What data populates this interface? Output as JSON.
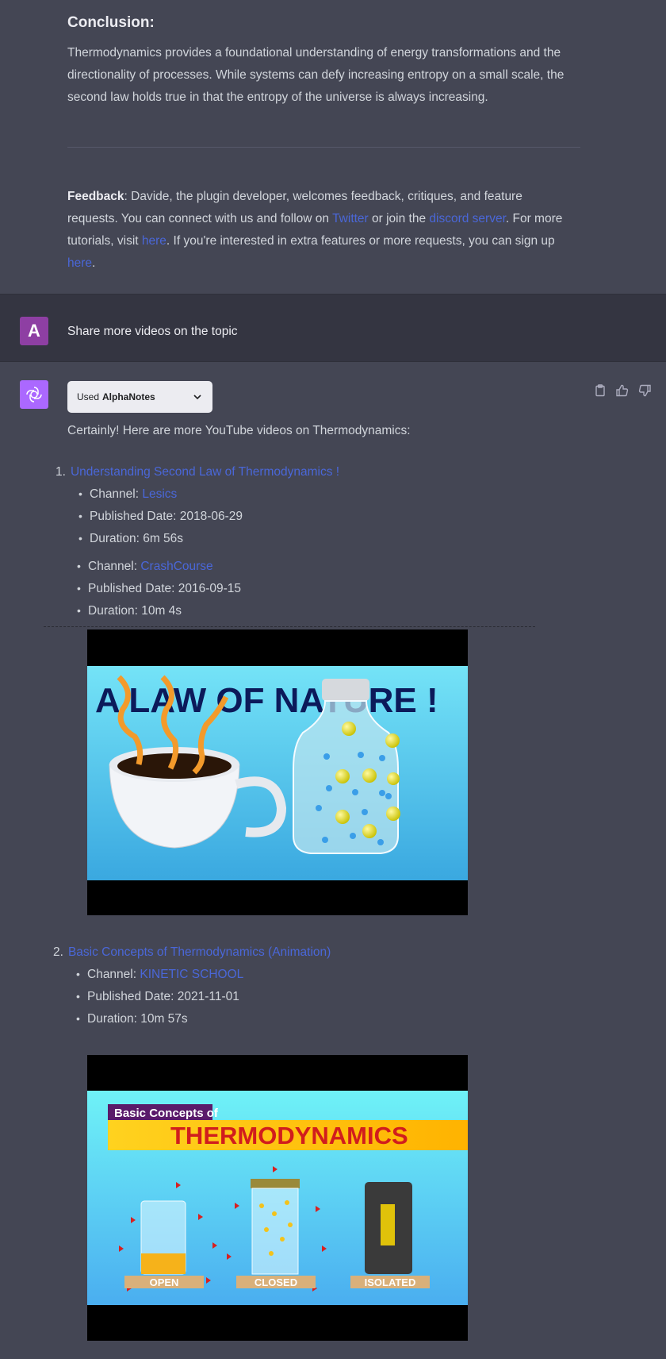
{
  "conclusion": {
    "heading": "Conclusion:",
    "text_lines": [
      "Thermodynamics provides a foundational understanding of energy transformations and the",
      "directionality of processes. While systems can defy increasing entropy on a small scale, the",
      "second law holds true in that the entropy of the universe is always increasing."
    ]
  },
  "feedback": {
    "label": "Feedback",
    "line1": ": Davide, the plugin developer, welcomes feedback, critiques, and feature",
    "line2_a": "requests. You can connect with us and follow on ",
    "twitter": "Twitter",
    "line2_b": " or join the ",
    "discord": "discord server",
    "line2_c": ". For more",
    "line3_a": "tutorials, visit ",
    "here1": "here",
    "line3_b": ". If you're interested in extra features or more requests, you can sign up",
    "here2": "here",
    "line4_end": "."
  },
  "user_message": {
    "avatar_letter": "A",
    "text": "Share more videos on the topic"
  },
  "assistant": {
    "plugin_used": "Used",
    "plugin_name": "AlphaNotes",
    "intro": "Certainly! Here are more YouTube videos on Thermodynamics:",
    "videos": [
      {
        "num": "1.",
        "title": "Understanding Second Law of Thermodynamics !",
        "channel_label": "Channel: ",
        "channel": "Lesics",
        "published": "Published Date: 2018-06-29",
        "duration": "Duration: 6m 56s"
      },
      {
        "num": "2.",
        "title": "Basic Concepts of Thermodynamics (Animation)",
        "channel_label": "Channel: ",
        "channel": "KINETIC SCHOOL",
        "published": "Published Date: 2021-11-01",
        "duration": "Duration: 10m 57s"
      }
    ],
    "extra_item": {
      "channel_label": "Channel: ",
      "channel": "CrashCourse",
      "published": "Published Date: 2016-09-15",
      "duration": "Duration: 10m 4s"
    },
    "thumb1": {
      "title": "A LAW OF NATURE !"
    },
    "thumb2": {
      "small_title": "Basic Concepts of",
      "big_title": "THERMODYNAMICS",
      "labels": [
        "OPEN",
        "CLOSED",
        "ISOLATED"
      ]
    }
  },
  "colors": {
    "bg": "#444654",
    "user_bg": "#343541",
    "link": "#4a67d8",
    "user_avatar": "#8e3fa3",
    "bot_avatar": "#ab68ff"
  }
}
